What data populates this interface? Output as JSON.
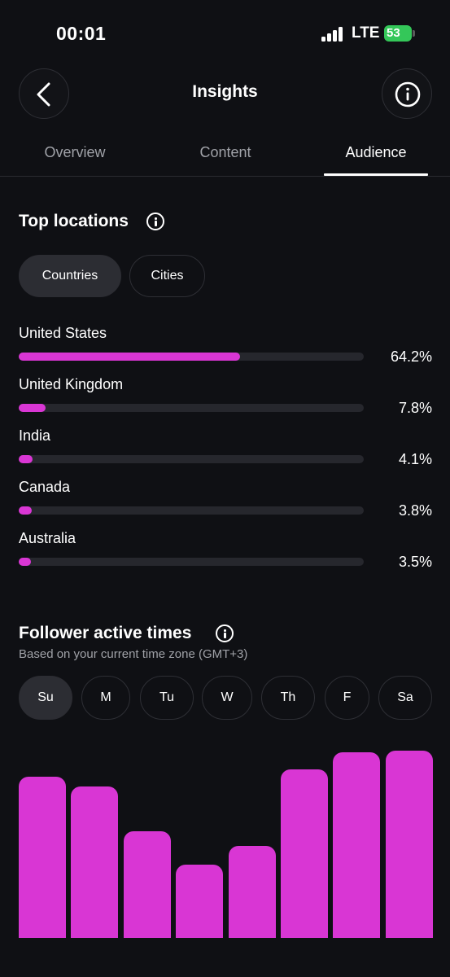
{
  "status_bar": {
    "time": "00:01",
    "network": "LTE",
    "battery": "53"
  },
  "header": {
    "title": "Insights"
  },
  "tabs": [
    {
      "label": "Overview",
      "active": false
    },
    {
      "label": "Content",
      "active": false
    },
    {
      "label": "Audience",
      "active": true
    }
  ],
  "top_locations": {
    "title": "Top locations",
    "filters": [
      {
        "label": "Countries",
        "selected": true
      },
      {
        "label": "Cities",
        "selected": false
      }
    ],
    "rows": [
      {
        "name": "United States",
        "percent_label": "64.2%",
        "fraction": 0.642
      },
      {
        "name": "United Kingdom",
        "percent_label": "7.8%",
        "fraction": 0.078
      },
      {
        "name": "India",
        "percent_label": "4.1%",
        "fraction": 0.041
      },
      {
        "name": "Canada",
        "percent_label": "3.8%",
        "fraction": 0.038
      },
      {
        "name": "Australia",
        "percent_label": "3.5%",
        "fraction": 0.035
      }
    ]
  },
  "active_times": {
    "title": "Follower active times",
    "subtitle": "Based on your current time zone (GMT+3)",
    "days": [
      {
        "label": "Su",
        "selected": true
      },
      {
        "label": "M",
        "selected": false
      },
      {
        "label": "Tu",
        "selected": false
      },
      {
        "label": "W",
        "selected": false
      },
      {
        "label": "Th",
        "selected": false
      },
      {
        "label": "F",
        "selected": false
      },
      {
        "label": "Sa",
        "selected": false
      }
    ]
  },
  "chart_data": {
    "type": "bar",
    "categories": [
      "",
      "",
      "",
      "",
      "",
      "",
      "",
      ""
    ],
    "values": [
      86,
      81,
      57,
      39,
      49,
      90,
      99,
      100
    ],
    "ylim": [
      0,
      100
    ],
    "color": "#d936d4"
  },
  "colors": {
    "accent": "#d936d4",
    "background": "#0f1014",
    "track": "#26272d"
  },
  "icons": {
    "back": "chevron-left-icon",
    "info": "info-icon"
  }
}
